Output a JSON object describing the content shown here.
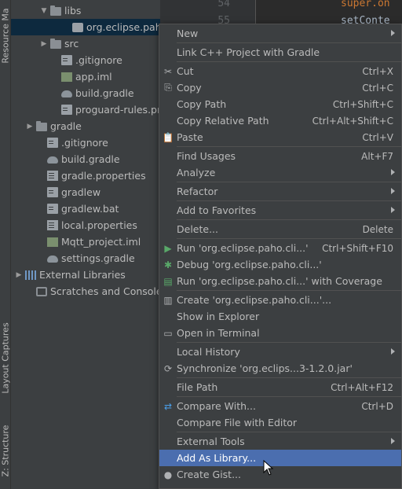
{
  "side_tabs": {
    "resource_manager": "Resource Ma",
    "layout_captures": "Layout Captures",
    "structure": "Z: Structure"
  },
  "tree": [
    {
      "label": "libs",
      "type": "folder",
      "arrow": "▼",
      "indent": 36
    },
    {
      "label": "org.eclipse.paho.cli",
      "type": "jar",
      "arrow": "",
      "indent": 64,
      "selected": true
    },
    {
      "label": "src",
      "type": "folder",
      "arrow": "▶",
      "indent": 36
    },
    {
      "label": ".gitignore",
      "type": "file",
      "arrow": "",
      "indent": 50
    },
    {
      "label": "app.iml",
      "type": "iml",
      "arrow": "",
      "indent": 50
    },
    {
      "label": "build.gradle",
      "type": "gradle",
      "arrow": "",
      "indent": 50
    },
    {
      "label": "proguard-rules.pro",
      "type": "file",
      "arrow": "",
      "indent": 50
    },
    {
      "label": "gradle",
      "type": "folder",
      "arrow": "▶",
      "indent": 18
    },
    {
      "label": ".gitignore",
      "type": "file",
      "arrow": "",
      "indent": 32
    },
    {
      "label": "build.gradle",
      "type": "gradle",
      "arrow": "",
      "indent": 32
    },
    {
      "label": "gradle.properties",
      "type": "props",
      "arrow": "",
      "indent": 32
    },
    {
      "label": "gradlew",
      "type": "file",
      "arrow": "",
      "indent": 32
    },
    {
      "label": "gradlew.bat",
      "type": "file",
      "arrow": "",
      "indent": 32
    },
    {
      "label": "local.properties",
      "type": "props",
      "arrow": "",
      "indent": 32
    },
    {
      "label": "Mqtt_project.iml",
      "type": "iml",
      "arrow": "",
      "indent": 32
    },
    {
      "label": "settings.gradle",
      "type": "gradle",
      "arrow": "",
      "indent": 32
    },
    {
      "label": "External Libraries",
      "type": "libs",
      "arrow": "▶",
      "indent": 4
    },
    {
      "label": "Scratches and Consoles",
      "type": "scratch",
      "arrow": "",
      "indent": 18
    }
  ],
  "editor": {
    "line_numbers": [
      "54",
      "55"
    ],
    "code_lines": [
      "super.on",
      "setConte"
    ]
  },
  "menu": [
    {
      "label": "New",
      "shortcut": "",
      "submenu": true,
      "icon": ""
    },
    {
      "sep": true
    },
    {
      "label": "Link C++ Project with Gradle",
      "shortcut": "",
      "icon": ""
    },
    {
      "sep": true
    },
    {
      "label": "Cut",
      "shortcut": "Ctrl+X",
      "icon": "✂"
    },
    {
      "label": "Copy",
      "shortcut": "Ctrl+C",
      "icon": "⎘"
    },
    {
      "label": "Copy Path",
      "shortcut": "Ctrl+Shift+C",
      "icon": ""
    },
    {
      "label": "Copy Relative Path",
      "shortcut": "Ctrl+Alt+Shift+C",
      "icon": ""
    },
    {
      "label": "Paste",
      "shortcut": "Ctrl+V",
      "icon": "📋"
    },
    {
      "sep": true
    },
    {
      "label": "Find Usages",
      "shortcut": "Alt+F7",
      "icon": ""
    },
    {
      "label": "Analyze",
      "shortcut": "",
      "submenu": true,
      "icon": ""
    },
    {
      "sep": true
    },
    {
      "label": "Refactor",
      "shortcut": "",
      "submenu": true,
      "icon": ""
    },
    {
      "sep": true
    },
    {
      "label": "Add to Favorites",
      "shortcut": "",
      "submenu": true,
      "icon": ""
    },
    {
      "sep": true
    },
    {
      "label": "Delete...",
      "shortcut": "Delete",
      "icon": ""
    },
    {
      "sep": true
    },
    {
      "label": "Run 'org.eclipse.paho.cli...'",
      "shortcut": "Ctrl+Shift+F10",
      "icon": "▶",
      "icon_color": "#59a869"
    },
    {
      "label": "Debug 'org.eclipse.paho.cli...'",
      "shortcut": "",
      "icon": "✱",
      "icon_color": "#59a869"
    },
    {
      "label": "Run 'org.eclipse.paho.cli...' with Coverage",
      "shortcut": "",
      "icon": "▤",
      "icon_color": "#59a869"
    },
    {
      "sep": true
    },
    {
      "label": "Create 'org.eclipse.paho.cli...'...",
      "shortcut": "",
      "icon": "▥"
    },
    {
      "label": "Show in Explorer",
      "shortcut": "",
      "icon": ""
    },
    {
      "label": "Open in Terminal",
      "shortcut": "",
      "icon": "▭"
    },
    {
      "sep": true
    },
    {
      "label": "Local History",
      "shortcut": "",
      "submenu": true,
      "icon": ""
    },
    {
      "label": "Synchronize 'org.eclips...3-1.2.0.jar'",
      "shortcut": "",
      "icon": "⟳"
    },
    {
      "sep": true
    },
    {
      "label": "File Path",
      "shortcut": "Ctrl+Alt+F12",
      "icon": ""
    },
    {
      "sep": true
    },
    {
      "label": "Compare With...",
      "shortcut": "Ctrl+D",
      "icon": "⇄",
      "icon_color": "#4a9ee8"
    },
    {
      "label": "Compare File with Editor",
      "shortcut": "",
      "icon": ""
    },
    {
      "sep": true
    },
    {
      "label": "External Tools",
      "shortcut": "",
      "submenu": true,
      "icon": ""
    },
    {
      "label": "Add As Library...",
      "shortcut": "",
      "icon": "",
      "highlighted": true
    },
    {
      "label": "Create Gist...",
      "shortcut": "",
      "icon": "●"
    }
  ],
  "colors": {
    "menu_highlight": "#4b6eaf",
    "tree_selected": "#0d293e",
    "background": "#3c3f41",
    "editor_bg": "#2b2b2b"
  }
}
